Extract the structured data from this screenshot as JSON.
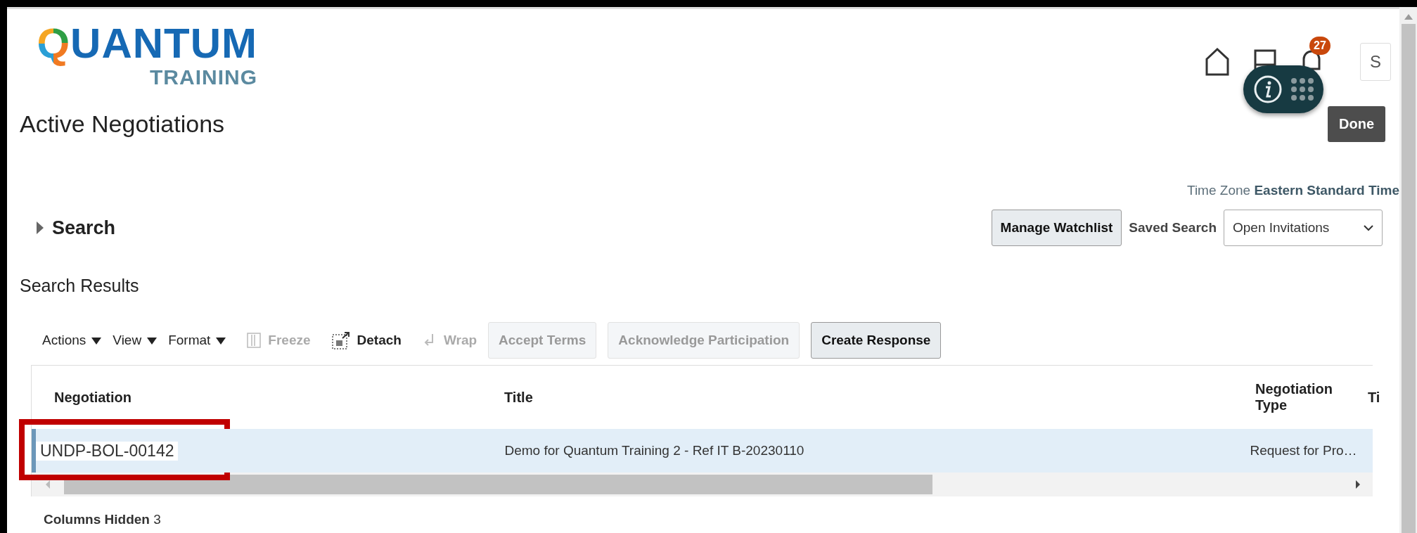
{
  "header": {
    "logo": {
      "word": "QUANTUM",
      "tagline": "TRAINING"
    },
    "notification_count": "27",
    "user_initial": "S",
    "done_button": "Done"
  },
  "page_title": "Active Negotiations",
  "time_zone": {
    "label": "Time Zone",
    "value": "Eastern Standard Time"
  },
  "search": {
    "label": "Search",
    "expanded": false
  },
  "manage_watchlist": "Manage Watchlist",
  "saved_search": {
    "label": "Saved Search",
    "value": "Open Invitations"
  },
  "results": {
    "title": "Search Results",
    "toolbar": [
      {
        "kind": "menu",
        "label": "Actions",
        "disabled": false
      },
      {
        "kind": "menu",
        "label": "View",
        "disabled": false
      },
      {
        "kind": "menu",
        "label": "Format",
        "disabled": false
      },
      {
        "kind": "freeze",
        "label": "Freeze",
        "disabled": true
      },
      {
        "kind": "detach",
        "label": "Detach",
        "disabled": false
      },
      {
        "kind": "wrap",
        "label": "Wrap",
        "disabled": true
      },
      {
        "kind": "button",
        "label": "Accept Terms",
        "disabled": true
      },
      {
        "kind": "button",
        "label": "Acknowledge Participation",
        "disabled": true
      },
      {
        "kind": "button",
        "label": "Create Response",
        "disabled": false
      }
    ],
    "columns": [
      "Negotiation",
      "Title",
      "Negotiation Type",
      "Ti"
    ],
    "rows": [
      {
        "cells": [
          "UNDP-BOL-00142",
          "Demo for Quantum Training 2 - Ref IT B-20230110",
          "Request for Pro…"
        ],
        "selected": true,
        "highlighted": true
      }
    ],
    "columns_hidden": {
      "label": "Columns Hidden",
      "value": "3"
    }
  }
}
